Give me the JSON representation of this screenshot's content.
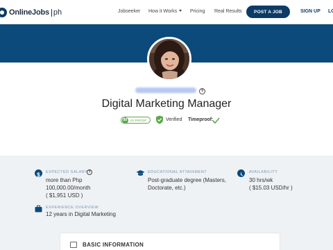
{
  "nav": {
    "logo_text": "OnlineJobs",
    "logo_suffix": "ph",
    "links": [
      "Jobseeker",
      "How it Works",
      "Pricing",
      "Real Results"
    ],
    "post_job": "POST A JOB",
    "sign_up": "SIGN UP",
    "login": "LO"
  },
  "profile": {
    "help": "?",
    "title": "Digital Marketing Manager",
    "id_score": "80",
    "id_label": "ID PROOF",
    "verified": "Verified",
    "timeproof": "Timeproof:"
  },
  "details": {
    "salary_label": "EXPECTED SALARY",
    "salary_help": "?",
    "salary_line1": "more than Php",
    "salary_line2": "100,000.00/month",
    "salary_line3": "( $1,951 USD )",
    "education_label": "EDUCATIONAL ATTAINMENT",
    "education_line1": "Post-graduate degree (Masters,",
    "education_line2": "Doctorate, etc.)",
    "availability_label": "AVAILABILITY",
    "availability_line1": "30 hrs/wk",
    "availability_line2": "( $15.03 USD/hr )",
    "experience_label": "EXPERIENCE OVERVIEW",
    "experience_value": "12 years in Digital Marketing"
  },
  "basic_info": {
    "title": "BASIC INFORMATION"
  },
  "colors": {
    "brand": "#0c4a7b",
    "verified_green": "#5aa94b",
    "details_bg": "#eef2f5"
  }
}
